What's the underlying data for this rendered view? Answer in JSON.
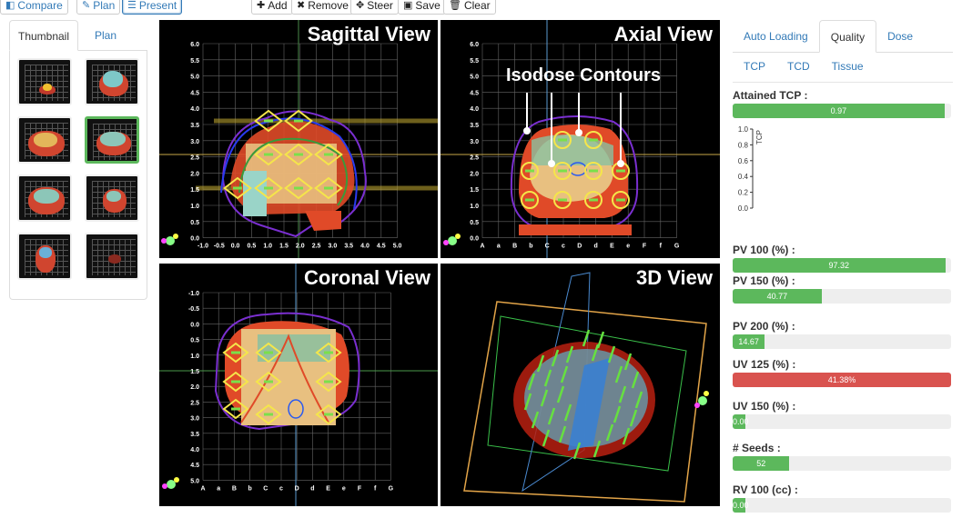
{
  "toolbar": {
    "compare": "Compare",
    "plan": "Plan",
    "present": "Present",
    "add": "Add",
    "remove": "Remove",
    "steer": "Steer",
    "save": "Save",
    "clear": "Clear"
  },
  "left_tabs": {
    "thumbnail": "Thumbnail",
    "plan": "Plan"
  },
  "views": {
    "sagittal": {
      "title": "Sagittal View",
      "y_ticks": [
        "6.0",
        "5.5",
        "5.0",
        "4.5",
        "4.0",
        "3.5",
        "3.0",
        "2.5",
        "2.0",
        "1.5",
        "1.0",
        "0.5",
        "0.0"
      ],
      "x_ticks": [
        "-1.0",
        "-0.5",
        "0.0",
        "0.5",
        "1.0",
        "1.5",
        "2.0",
        "2.5",
        "3.0",
        "3.5",
        "4.0",
        "4.5",
        "5.0"
      ]
    },
    "axial": {
      "title": "Axial View",
      "annotation": "Isodose Contours",
      "y_ticks": [
        "6.0",
        "5.5",
        "5.0",
        "4.5",
        "4.0",
        "3.5",
        "3.0",
        "2.5",
        "2.0",
        "1.5",
        "1.0",
        "0.5",
        "0.0"
      ],
      "x_ticks": [
        "A",
        "a",
        "B",
        "b",
        "C",
        "c",
        "D",
        "d",
        "E",
        "e",
        "F",
        "f",
        "G"
      ]
    },
    "coronal": {
      "title": "Coronal View",
      "y_ticks": [
        "-1.0",
        "-0.5",
        "0.0",
        "0.5",
        "1.0",
        "1.5",
        "2.0",
        "2.5",
        "3.0",
        "3.5",
        "4.0",
        "4.5",
        "5.0"
      ],
      "x_ticks": [
        "A",
        "a",
        "B",
        "b",
        "C",
        "c",
        "D",
        "d",
        "E",
        "e",
        "F",
        "f",
        "G"
      ]
    },
    "threed": {
      "title": "3D View"
    }
  },
  "right_tabs": {
    "auto_loading": "Auto Loading",
    "quality": "Quality",
    "dose": "Dose"
  },
  "sub_tabs": {
    "tcp": "TCP",
    "tcd": "TCD",
    "tissue": "Tissue"
  },
  "tcp_chart": {
    "axis_label": "TCP",
    "ticks": [
      "1.0",
      "0.8",
      "0.6",
      "0.4",
      "0.2",
      "0.0"
    ]
  },
  "metrics": [
    {
      "label": "Attained TCP :",
      "value_text": "0.97",
      "fraction": 0.97,
      "color": "#5cb85c"
    },
    {
      "label": "PV 100 (%) :",
      "value_text": "97.32",
      "fraction": 0.9732,
      "color": "#5cb85c"
    },
    {
      "label": "PV 150 (%) :",
      "value_text": "40.77",
      "fraction": 0.4077,
      "color": "#5cb85c"
    },
    {
      "label": "PV 200 (%) :",
      "value_text": "14.67",
      "fraction": 0.1467,
      "color": "#5cb85c"
    },
    {
      "label": "UV 125 (%) :",
      "value_text": "41.38%",
      "fraction": 1.0,
      "color": "#d9534f"
    },
    {
      "label": "UV 150 (%) :",
      "value_text": "0.00",
      "fraction": 0.06,
      "color": "#5cb85c"
    },
    {
      "label": "# Seeds :",
      "value_text": "52",
      "fraction": 0.26,
      "color": "#5cb85c"
    },
    {
      "label": "RV 100 (cc) :",
      "value_text": "0.00",
      "fraction": 0.06,
      "color": "#5cb85c"
    }
  ],
  "colors": {
    "accent": "#337ab7",
    "good": "#5cb85c",
    "bad": "#d9534f"
  }
}
